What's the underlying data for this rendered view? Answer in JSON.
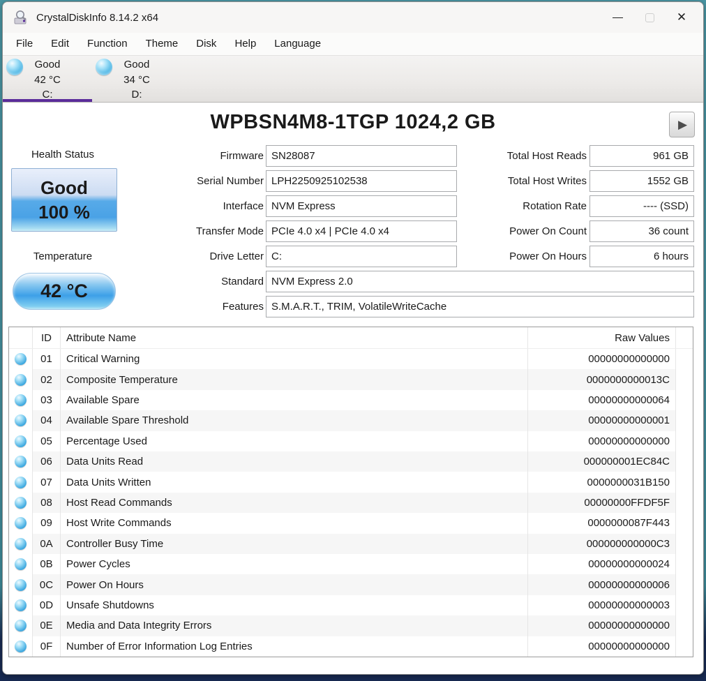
{
  "window": {
    "title": "CrystalDiskInfo 8.14.2 x64",
    "minimize_glyph": "—",
    "close_glyph": "✕"
  },
  "menu": {
    "items": [
      "File",
      "Edit",
      "Function",
      "Theme",
      "Disk",
      "Help",
      "Language"
    ]
  },
  "drive_tabs": [
    {
      "status": "Good",
      "temperature": "42 °C",
      "letter": "C:",
      "selected": true
    },
    {
      "status": "Good",
      "temperature": "34 °C",
      "letter": "D:",
      "selected": false
    }
  ],
  "drive": {
    "title": "WPBSN4M8-1TGP 1024,2 GB",
    "play_icon": "▶",
    "health": {
      "label": "Health Status",
      "status": "Good",
      "percent": "100 %"
    },
    "temperature": {
      "label": "Temperature",
      "value": "42 °C"
    },
    "info_fields": [
      {
        "label": "Firmware",
        "value": "SN28087",
        "wide": false
      },
      {
        "label": "Serial Number",
        "value": "LPH2250925102538",
        "wide": false
      },
      {
        "label": "Interface",
        "value": "NVM Express",
        "wide": false
      },
      {
        "label": "Transfer Mode",
        "value": "PCIe 4.0 x4 | PCIe 4.0 x4",
        "wide": false
      },
      {
        "label": "Drive Letter",
        "value": "C:",
        "wide": false
      },
      {
        "label": "Standard",
        "value": "NVM Express 2.0",
        "wide": true
      },
      {
        "label": "Features",
        "value": "S.M.A.R.T., TRIM, VolatileWriteCache",
        "wide": true
      }
    ],
    "stat_fields": [
      {
        "label": "Total Host Reads",
        "value": "961 GB"
      },
      {
        "label": "Total Host Writes",
        "value": "1552 GB"
      },
      {
        "label": "Rotation Rate",
        "value": "---- (SSD)"
      },
      {
        "label": "Power On Count",
        "value": "36 count"
      },
      {
        "label": "Power On Hours",
        "value": "6 hours"
      }
    ]
  },
  "smart_table": {
    "columns": {
      "id": "ID",
      "name": "Attribute Name",
      "raw": "Raw Values"
    },
    "rows": [
      {
        "id": "01",
        "name": "Critical Warning",
        "raw": "00000000000000"
      },
      {
        "id": "02",
        "name": "Composite Temperature",
        "raw": "0000000000013C"
      },
      {
        "id": "03",
        "name": "Available Spare",
        "raw": "00000000000064"
      },
      {
        "id": "04",
        "name": "Available Spare Threshold",
        "raw": "00000000000001"
      },
      {
        "id": "05",
        "name": "Percentage Used",
        "raw": "00000000000000"
      },
      {
        "id": "06",
        "name": "Data Units Read",
        "raw": "000000001EC84C"
      },
      {
        "id": "07",
        "name": "Data Units Written",
        "raw": "0000000031B150"
      },
      {
        "id": "08",
        "name": "Host Read Commands",
        "raw": "00000000FFDF5F"
      },
      {
        "id": "09",
        "name": "Host Write Commands",
        "raw": "0000000087F443"
      },
      {
        "id": "0A",
        "name": "Controller Busy Time",
        "raw": "000000000000C3"
      },
      {
        "id": "0B",
        "name": "Power Cycles",
        "raw": "00000000000024"
      },
      {
        "id": "0C",
        "name": "Power On Hours",
        "raw": "00000000000006"
      },
      {
        "id": "0D",
        "name": "Unsafe Shutdowns",
        "raw": "00000000000003"
      },
      {
        "id": "0E",
        "name": "Media and Data Integrity Errors",
        "raw": "00000000000000"
      },
      {
        "id": "0F",
        "name": "Number of Error Information Log Entries",
        "raw": "00000000000000"
      }
    ]
  },
  "colors": {
    "health_good_blue": "#3da0e8",
    "tab_underline_purple": "#5b2c9a",
    "orb_blue": "#35a3dc"
  }
}
